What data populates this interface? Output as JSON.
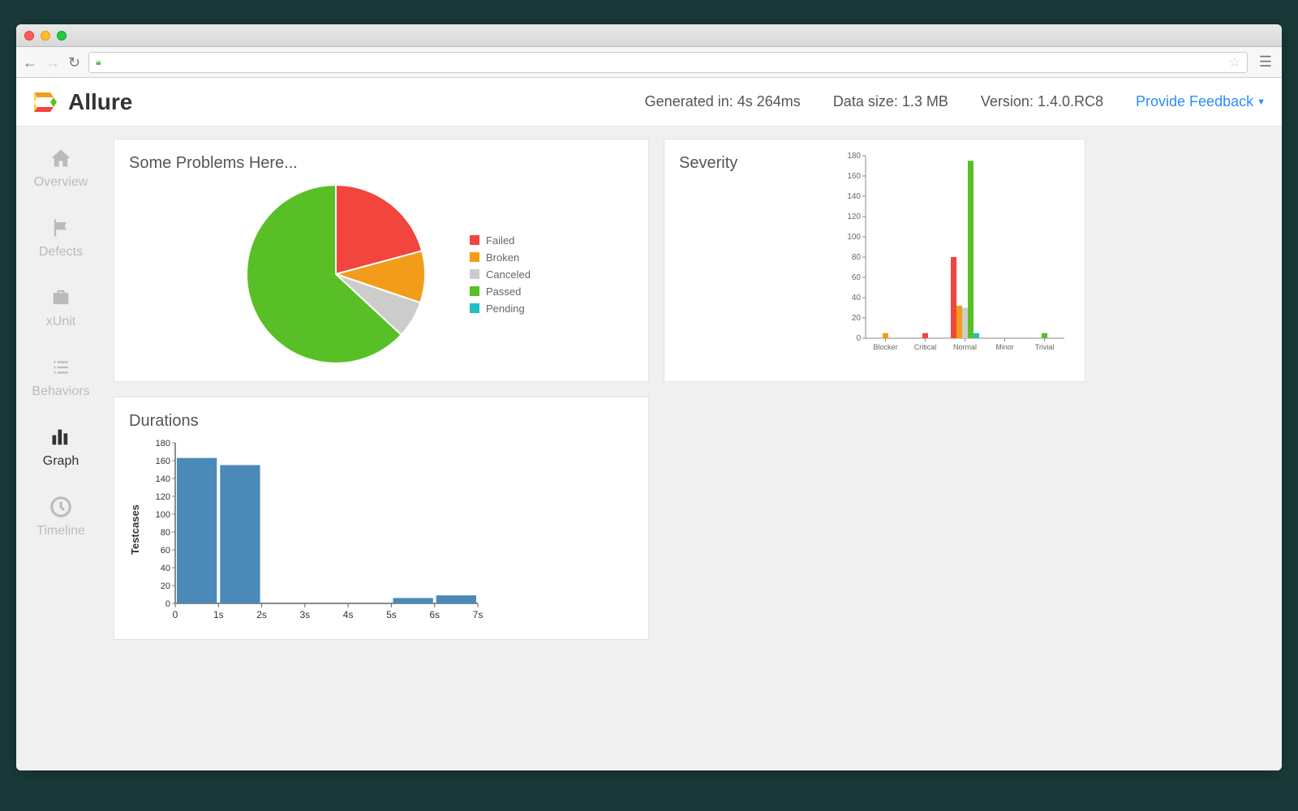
{
  "app_title": "Allure",
  "header": {
    "generated_label": "Generated in:",
    "generated_value": "4s 264ms",
    "size_label": "Data size:",
    "size_value": "1.3 MB",
    "version_label": "Version:",
    "version_value": "1.4.0.RC8",
    "feedback": "Provide Feedback"
  },
  "sidebar": {
    "items": [
      {
        "label": "Overview",
        "icon": "home"
      },
      {
        "label": "Defects",
        "icon": "flag"
      },
      {
        "label": "xUnit",
        "icon": "briefcase"
      },
      {
        "label": "Behaviors",
        "icon": "list"
      },
      {
        "label": "Graph",
        "icon": "bars",
        "active": true
      },
      {
        "label": "Timeline",
        "icon": "clock"
      }
    ]
  },
  "cards": {
    "problems_title": "Some Problems Here...",
    "severity_title": "Severity",
    "durations_title": "Durations",
    "durations_ylabel": "Testcases"
  },
  "status_colors": {
    "failed": "#f1453d",
    "broken": "#f39c19",
    "canceled": "#cccccc",
    "passed": "#58c026",
    "pending": "#1fc1c3"
  },
  "chart_data": [
    {
      "id": "problems_pie",
      "type": "pie",
      "title": "Some Problems Here...",
      "series": [
        {
          "name": "Failed",
          "value": 62,
          "color": "#f1453d"
        },
        {
          "name": "Broken",
          "value": 28,
          "color": "#f39c19"
        },
        {
          "name": "Canceled",
          "value": 20,
          "color": "#cccccc"
        },
        {
          "name": "Passed",
          "value": 188,
          "color": "#58c026"
        },
        {
          "name": "Pending",
          "value": 0,
          "color": "#1fc1c3"
        }
      ],
      "legend": [
        "Failed",
        "Broken",
        "Canceled",
        "Passed",
        "Pending"
      ]
    },
    {
      "id": "severity_bar",
      "type": "bar",
      "title": "Severity",
      "categories": [
        "Blocker",
        "Critical",
        "Normal",
        "Minor",
        "Trivial"
      ],
      "series": [
        {
          "name": "Failed",
          "color": "#f1453d",
          "values": [
            0,
            5,
            80,
            0,
            0
          ]
        },
        {
          "name": "Broken",
          "color": "#f39c19",
          "values": [
            5,
            0,
            32,
            0,
            0
          ]
        },
        {
          "name": "Canceled",
          "color": "#cccccc",
          "values": [
            0,
            0,
            30,
            0,
            0
          ]
        },
        {
          "name": "Passed",
          "color": "#58c026",
          "values": [
            0,
            0,
            175,
            0,
            5
          ]
        },
        {
          "name": "Pending",
          "color": "#1fc1c3",
          "values": [
            0,
            0,
            5,
            0,
            0
          ]
        }
      ],
      "ylim": [
        0,
        180
      ],
      "yticks": [
        0,
        20,
        40,
        60,
        80,
        100,
        120,
        140,
        160,
        180
      ]
    },
    {
      "id": "durations_bar",
      "type": "bar",
      "title": "Durations",
      "xlabel": "",
      "ylabel": "Testcases",
      "categories": [
        "0",
        "1s",
        "2s",
        "3s",
        "4s",
        "5s",
        "6s",
        "7s"
      ],
      "values": [
        163,
        155,
        0,
        0,
        0,
        6,
        9,
        0
      ],
      "ylim": [
        0,
        180
      ],
      "yticks": [
        0,
        20,
        40,
        60,
        80,
        100,
        120,
        140,
        160,
        180
      ],
      "bar_color": "#4a89b8"
    }
  ]
}
